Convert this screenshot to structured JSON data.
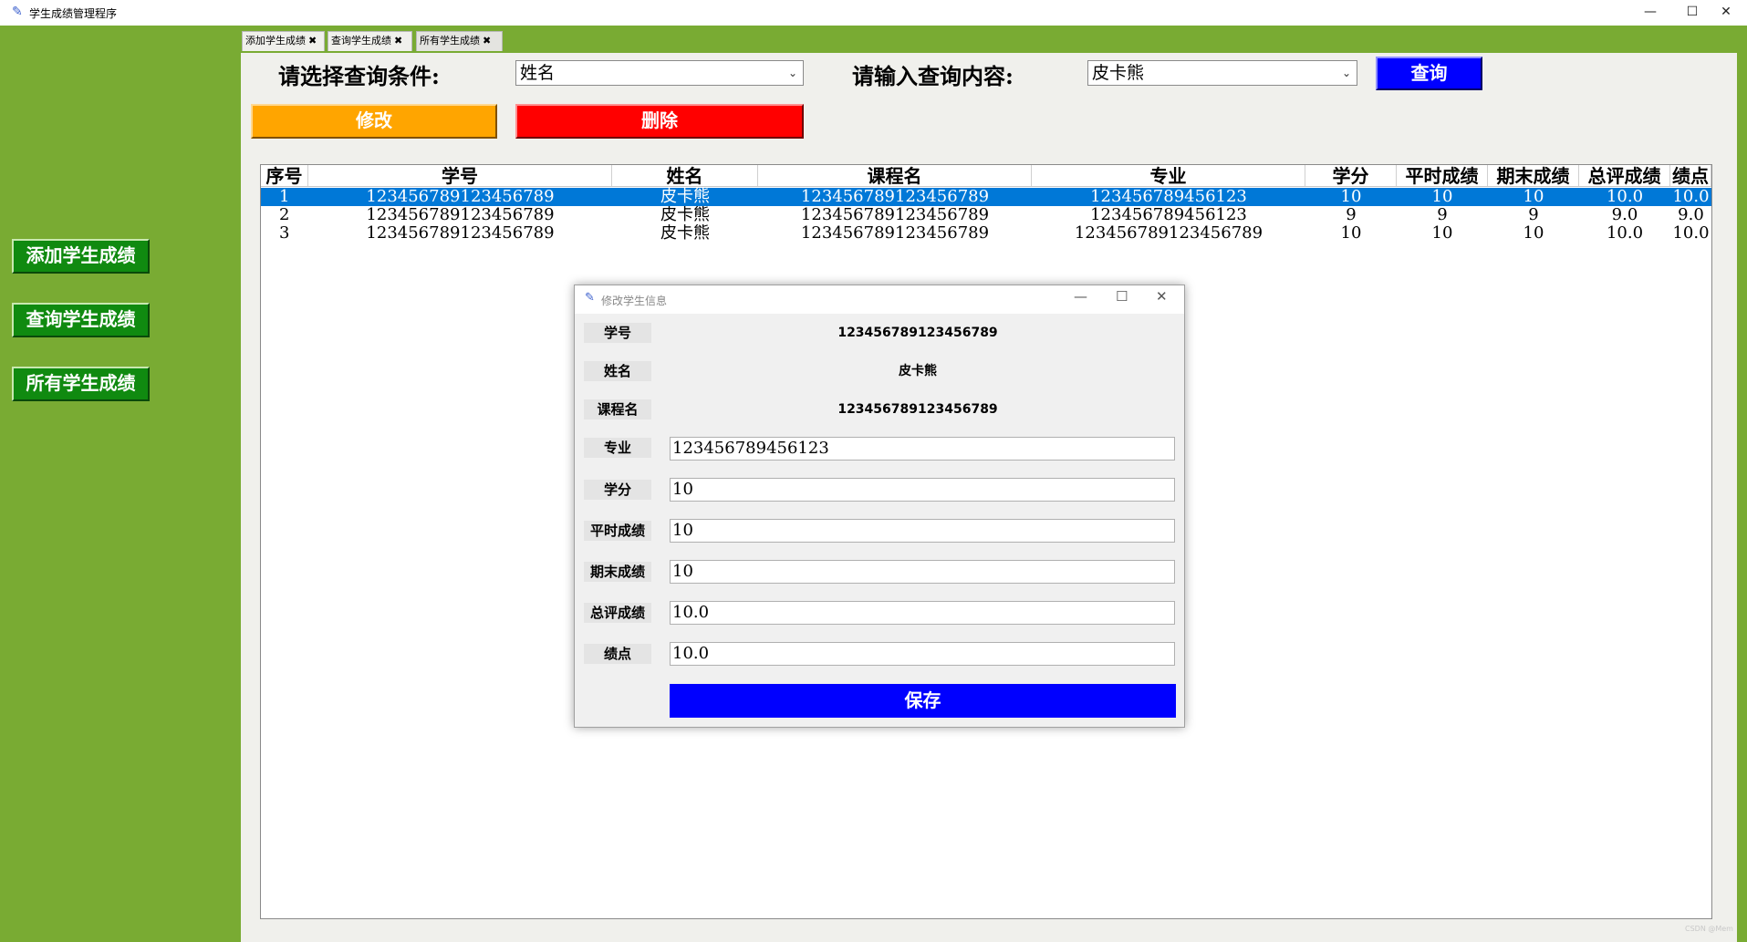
{
  "window": {
    "title": "学生成绩管理程序",
    "min_glyph": "—",
    "max_glyph": "☐",
    "close_glyph": "✕",
    "icon": "feather-icon"
  },
  "sidebar": {
    "items": [
      {
        "label": "添加学生成绩"
      },
      {
        "label": "查询学生成绩"
      },
      {
        "label": "所有学生成绩"
      }
    ]
  },
  "tabs": [
    {
      "label": "添加学生成绩"
    },
    {
      "label": "查询学生成绩"
    },
    {
      "label": "所有学生成绩"
    }
  ],
  "tab_close_glyph": "✖",
  "query": {
    "condition_label": "请选择查询条件:",
    "condition_value": "姓名",
    "content_label": "请输入查询内容:",
    "content_value": "皮卡熊",
    "search_label": "查询",
    "dropdown_glyph": "⌄"
  },
  "actions": {
    "edit_label": "修改",
    "delete_label": "删除"
  },
  "table": {
    "headers": [
      "序号",
      "学号",
      "姓名",
      "课程名",
      "专业",
      "学分",
      "平时成绩",
      "期末成绩",
      "总评成绩",
      "绩点"
    ],
    "rows": [
      [
        "1",
        "123456789123456789",
        "皮卡熊",
        "123456789123456789",
        "123456789456123",
        "10",
        "10",
        "10",
        "10.0",
        "10.0"
      ],
      [
        "2",
        "123456789123456789",
        "皮卡熊",
        "123456789123456789",
        "123456789456123",
        "9",
        "9",
        "9",
        "9.0",
        "9.0"
      ],
      [
        "3",
        "123456789123456789",
        "皮卡熊",
        "123456789123456789",
        "123456789123456789",
        "10",
        "10",
        "10",
        "10.0",
        "10.0"
      ]
    ],
    "selected_row": 0
  },
  "dialog": {
    "title": "修改学生信息",
    "min_glyph": "—",
    "max_glyph": "☐",
    "close_glyph": "✕",
    "readonly_fields": [
      {
        "label": "学号",
        "value": "123456789123456789"
      },
      {
        "label": "姓名",
        "value": "皮卡熊"
      },
      {
        "label": "课程名",
        "value": "123456789123456789"
      }
    ],
    "input_fields": [
      {
        "label": "专业",
        "value": "123456789456123"
      },
      {
        "label": "学分",
        "value": "10"
      },
      {
        "label": "平时成绩",
        "value": "10"
      },
      {
        "label": "期末成绩",
        "value": "10"
      },
      {
        "label": "总评成绩",
        "value": "10.0"
      },
      {
        "label": "绩点",
        "value": "10.0"
      }
    ],
    "save_label": "保存"
  },
  "watermark": "CSDN @Mem",
  "colors": {
    "frame_green": "#79ab33",
    "sidebar_button": "#108a10",
    "search_blue": "#0000ff",
    "edit_orange": "#ffa500",
    "delete_red": "#ff0000",
    "selection_blue": "#0078d7"
  }
}
